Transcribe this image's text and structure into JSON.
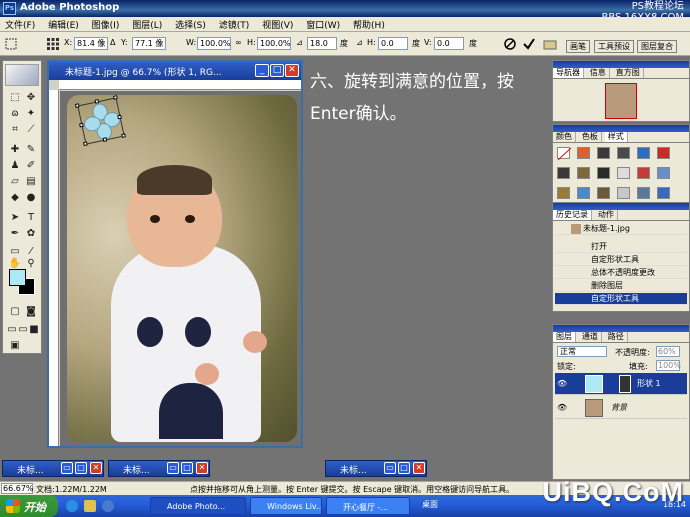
{
  "titlebar": {
    "title": "Adobe Photoshop",
    "watermark_line1": "PS教程论坛",
    "watermark_line2": "BBS.16XX8.COM"
  },
  "menu": [
    "文件(F)",
    "编辑(E)",
    "图像(I)",
    "图层(L)",
    "选择(S)",
    "滤镜(T)",
    "视图(V)",
    "窗口(W)",
    "帮助(H)"
  ],
  "options": {
    "x_label": "X:",
    "x_value": "81.4 像",
    "y_label": "Y:",
    "y_value": "77.1 像",
    "w_label": "W:",
    "w_value": "100.0%",
    "h_label": "H:",
    "h_value": "100.0%",
    "angle_value": "18.0",
    "angle_unit": "度",
    "hskew_label": "H:",
    "hskew_value": "0.0",
    "hskew_unit": "度",
    "vskew_label": "V:",
    "vskew_value": "0.0",
    "vskew_unit": "度",
    "tab_brushes": "画笔",
    "tab_presets": "工具预设",
    "tab_comps": "图层复合"
  },
  "document": {
    "title": "未标题-1.jpg @ 66.7% (形状 1, RG..."
  },
  "instruction": {
    "line1": "六、旋转到满意的位置，按",
    "line2": "Enter确认。"
  },
  "navigator_panel": {
    "tabs": [
      "导航器",
      "信息",
      "直方图"
    ]
  },
  "swatches_panel": {
    "tabs": [
      "颜色",
      "色板",
      "样式"
    ]
  },
  "history_panel": {
    "tabs": [
      "历史记录",
      "动作"
    ],
    "snapshot": "未标题-1.jpg",
    "items": [
      "打开",
      "自定形状工具",
      "总体不透明度更改",
      "删除图层",
      "自定形状工具"
    ]
  },
  "layers_panel": {
    "tabs": [
      "图层",
      "通道",
      "路径"
    ],
    "blend_mode": "正常",
    "opacity_label": "不透明度:",
    "opacity_value": "60%",
    "lock_label": "锁定:",
    "fill_label": "填充:",
    "fill_value": "100%",
    "layers": [
      "形状 1",
      "背景"
    ]
  },
  "minimized_docs": [
    "未标...",
    "未标...",
    "未标..."
  ],
  "status": {
    "zoom": "66.67%",
    "doc": "文档:1.22M/1.22M",
    "hint": "点按并拖移可从角上测量。按 Enter 键提交。按 Escape 键取消。用空格键访问导航工具。"
  },
  "taskbar": {
    "start": "开始",
    "items": [
      "Adobe Photo...",
      "Windows Liv...",
      "开心餐厅 -...",
      "桌面"
    ],
    "clock": "18:14"
  },
  "brand": "UiBQ.CoM",
  "colors": {
    "foreground": "#aee8f4",
    "background": "#000000",
    "titlebar": "#0a246a",
    "canvas_bg": "#737373"
  }
}
